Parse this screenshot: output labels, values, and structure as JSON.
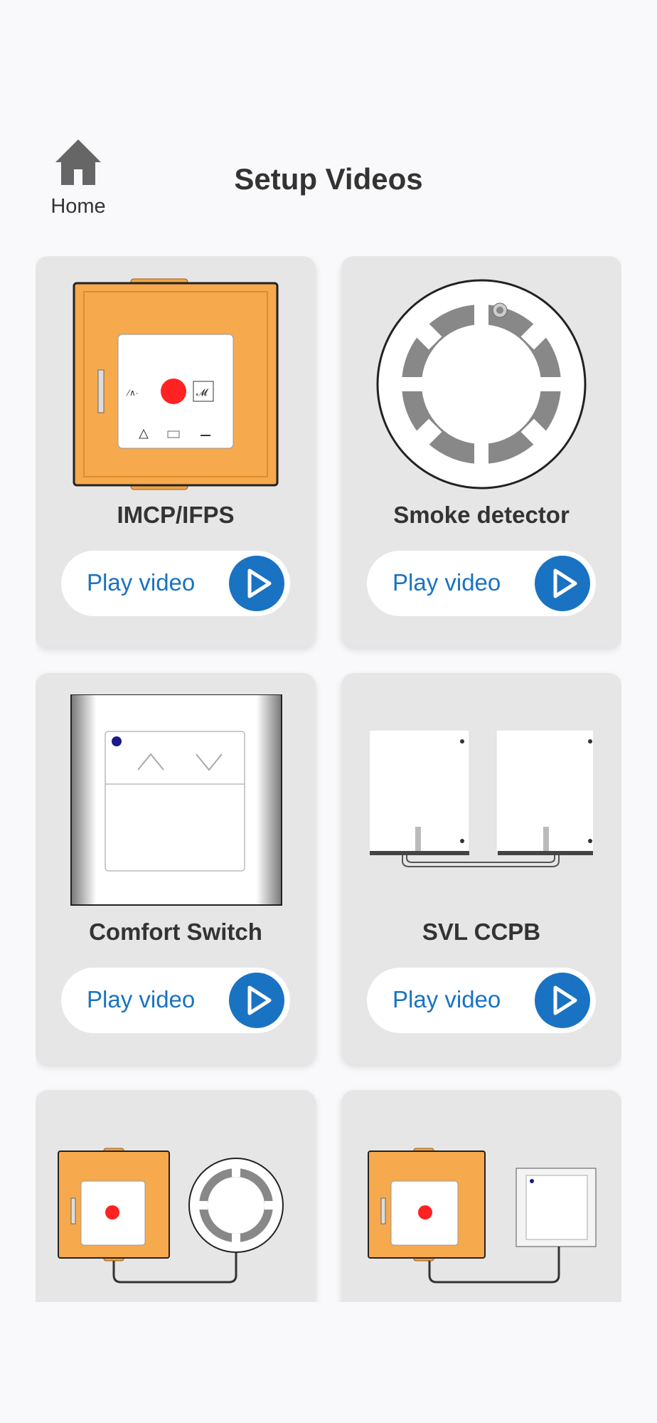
{
  "header": {
    "home_label": "Home",
    "title": "Setup Videos"
  },
  "colors": {
    "accent": "#1a73c2",
    "device_orange": "#f6a94d",
    "card_bg": "#e6e6e6"
  },
  "cards": [
    {
      "title": "IMCP/IFPS",
      "play_label": "Play video",
      "image": "imcp-ifps-device"
    },
    {
      "title": "Smoke detector",
      "play_label": "Play video",
      "image": "smoke-detector-device"
    },
    {
      "title": "Comfort Switch",
      "play_label": "Play video",
      "image": "comfort-switch-device"
    },
    {
      "title": "SVL CCPB",
      "play_label": "Play video",
      "image": "svl-ccpb-device"
    },
    {
      "title": "",
      "play_label": "",
      "image": "imcp-plus-smoke-detector"
    },
    {
      "title": "",
      "play_label": "",
      "image": "imcp-plus-comfort-switch"
    }
  ]
}
